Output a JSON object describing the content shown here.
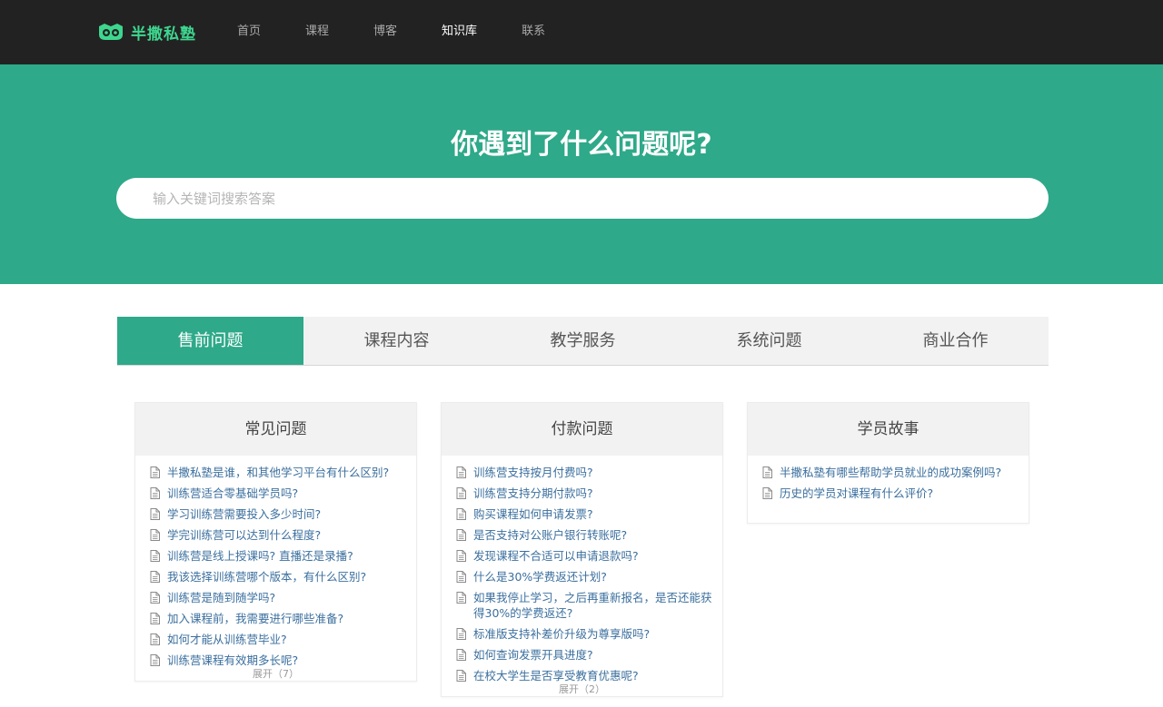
{
  "brand": {
    "name": "半撒私塾",
    "accent": "#3ed68f"
  },
  "nav": [
    {
      "label": "首页",
      "active": false
    },
    {
      "label": "课程",
      "active": false
    },
    {
      "label": "博客",
      "active": false
    },
    {
      "label": "知识库",
      "active": true
    },
    {
      "label": "联系",
      "active": false
    }
  ],
  "hero": {
    "title": "你遇到了什么问题呢?",
    "search_placeholder": "输入关键词搜索答案",
    "background": "#2ea989"
  },
  "tabs": [
    {
      "label": "售前问题",
      "active": true
    },
    {
      "label": "课程内容",
      "active": false
    },
    {
      "label": "教学服务",
      "active": false
    },
    {
      "label": "系统问题",
      "active": false
    },
    {
      "label": "商业合作",
      "active": false
    }
  ],
  "sections": [
    {
      "title": "常见问题",
      "questions": [
        "半撒私塾是谁，和其他学习平台有什么区别?",
        "训练营适合零基础学员吗?",
        "学习训练营需要投入多少时间?",
        "学完训练营可以达到什么程度?",
        "训练营是线上授课吗? 直播还是录播?",
        "我该选择训练营哪个版本，有什么区别?",
        "训练营是随到随学吗?",
        "加入课程前，我需要进行哪些准备?",
        "如何才能从训练营毕业?",
        "训练营课程有效期多长呢?"
      ],
      "expand_label": "展开（7）"
    },
    {
      "title": "付款问题",
      "questions": [
        "训练营支持按月付费吗?",
        "训练营支持分期付款吗?",
        "购买课程如何申请发票?",
        "是否支持对公账户银行转账呢?",
        "发现课程不合适可以申请退款吗?",
        "什么是30%学费返还计划?",
        "如果我停止学习，之后再重新报名，是否还能获得30%的学费返还?",
        "标准版支持补差价升级为尊享版吗?",
        "如何查询发票开具进度?",
        "在校大学生是否享受教育优惠呢?"
      ],
      "expand_label": "展开（2）"
    },
    {
      "title": "学员故事",
      "questions": [
        "半撒私塾有哪些帮助学员就业的成功案例吗?",
        "历史的学员对课程有什么评价?"
      ],
      "expand_label": ""
    }
  ]
}
